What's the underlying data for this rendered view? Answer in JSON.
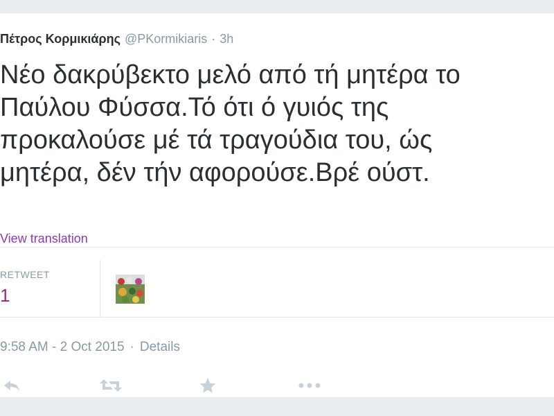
{
  "tweet": {
    "display_name": "Πέτρος Κορμικιάρης",
    "username": "@PKormikiaris",
    "separator": "·",
    "age": "3h",
    "text_lines": [
      "Νέο δακρύβεκτο μελό από τή μητέρα το",
      "Παύλου Φύσσα.Τό ότι ό γυιός της",
      "προκαλούσε μέ τά τραγούδια του, ώς",
      "μητέρα, δέν τήν αφορούσε.Βρέ ούστ."
    ],
    "translate_label": "View translation"
  },
  "stats": {
    "retweet_label": "RETWEET",
    "retweet_count": "1"
  },
  "meta": {
    "timestamp": "9:58 AM - 2 Oct 2015",
    "separator": "·",
    "details_label": "Details"
  },
  "actions": {
    "reply_icon": "reply-icon",
    "retweet_icon": "retweet-icon",
    "favorite_icon": "star-icon",
    "more_icon": "more-icon"
  },
  "colors": {
    "text": "#292f33",
    "muted": "#8899a6",
    "link": "#8a3ab9",
    "count": "#a0306a",
    "border": "#e1e8ed"
  }
}
